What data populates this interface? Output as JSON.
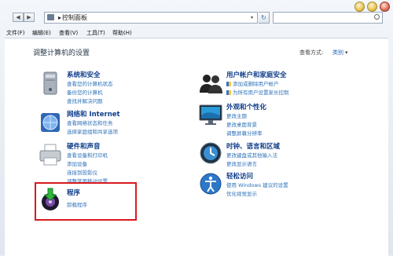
{
  "address": {
    "path": "控制面板",
    "separator": "▸",
    "dropdown_arrow": "▾"
  },
  "search": {
    "placeholder": ""
  },
  "menu": [
    "文件(F)",
    "编辑(E)",
    "查看(V)",
    "工具(T)",
    "帮助(H)"
  ],
  "page": {
    "heading": "调整计算机的设置",
    "view_by_label": "查看方式:",
    "view_by_value": "类别"
  },
  "categories": [
    {
      "title": "系统和安全",
      "icon": "computer-tower-icon",
      "links": [
        "查看您的计算机状态",
        "备份您的计算机",
        "查找并解决问题"
      ]
    },
    {
      "title": "网络和 Internet",
      "icon": "network-globe-icon",
      "links": [
        "查看网络状态和任务",
        "选择家庭组和共享选项"
      ]
    },
    {
      "title": "硬件和声音",
      "icon": "printer-icon",
      "links": [
        "查看设备和打印机",
        "添加设备",
        "连接到投影仪",
        "调整常用移动设置"
      ]
    },
    {
      "title": "程序",
      "icon": "program-install-icon",
      "links": [
        "卸载程序"
      ]
    },
    {
      "title": "用户帐户和家庭安全",
      "icon": "users-icon",
      "links": [
        "添加或删除用户帐户",
        "为所有用户设置家长控制"
      ]
    },
    {
      "title": "外观和个性化",
      "icon": "monitor-icon",
      "links": [
        "更改主题",
        "更改桌面背景",
        "调整屏幕分辨率"
      ]
    },
    {
      "title": "时钟、语言和区域",
      "icon": "clock-globe-icon",
      "links": [
        "更改键盘或其他输入法",
        "更改显示语言"
      ]
    },
    {
      "title": "轻松访问",
      "icon": "accessibility-icon",
      "links": [
        "使用 Windows 建议的设置",
        "优化视觉显示"
      ]
    }
  ],
  "colors": {
    "highlight_border": "#d9191f",
    "link": "#2f72b8",
    "title": "#0e3c8a"
  }
}
